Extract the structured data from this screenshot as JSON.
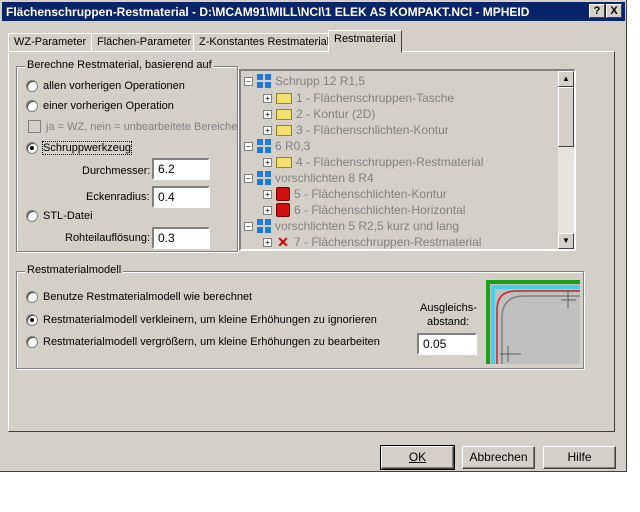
{
  "window": {
    "title": "Flächenschruppen-Restmaterial - D:\\MCAM91\\MILL\\NCI\\1 ELEK AS KOMPAKT.NCI - MPHEID",
    "help_button": "?",
    "close_button": "X"
  },
  "tabs": [
    {
      "label": "WZ-Parameter"
    },
    {
      "label": "Flächen-Parameter"
    },
    {
      "label": "Z-Konstantes Restmaterial"
    },
    {
      "label": "Restmaterial"
    }
  ],
  "calc_group": {
    "title": "Berechne Restmaterial, basierend auf",
    "options": [
      {
        "label": "allen vorherigen Operationen",
        "selected": false
      },
      {
        "label": "einer vorherigen Operation",
        "selected": false
      },
      {
        "label": "Schruppwerkzeug",
        "selected": true
      },
      {
        "label": "STL-Datei",
        "selected": false
      }
    ],
    "checkbox_label": "ja = WZ, nein = unbearbeitete Bereiche",
    "durchmesser_label": "Durchmesser:",
    "durchmesser_value": "6.2",
    "eckenradius_label": "Eckenradius:",
    "eckenradius_value": "0.4",
    "rohteil_label": "Rohteilauflösung:",
    "rohteil_value": "0.3"
  },
  "tree": {
    "items": [
      {
        "text": "Schrupp 12 R1,5",
        "kind": "group"
      },
      {
        "text": "1 - Flächenschruppen-Tasche",
        "kind": "folder"
      },
      {
        "text": "2 - Kontur (2D)",
        "kind": "folder"
      },
      {
        "text": "3 - Flächenschlichten-Kontur",
        "kind": "folder"
      },
      {
        "text": "6 R0,3",
        "kind": "group"
      },
      {
        "text": "4 - Flächenschruppen-Restmaterial",
        "kind": "folder"
      },
      {
        "text": "vorschlichten 8 R4",
        "kind": "group"
      },
      {
        "text": "5 - Flächenschlichten-Kontur",
        "kind": "red"
      },
      {
        "text": "6 - Flächenschlichten-Horizontal",
        "kind": "red"
      },
      {
        "text": "vorschlichten 5 R2,5 kurz und lang",
        "kind": "group"
      },
      {
        "text": "7 - Flächenschruppen-Restmaterial",
        "kind": "x"
      }
    ]
  },
  "model_group": {
    "title": "Restmaterialmodell",
    "options": [
      {
        "label": "Benutze Restmaterialmodell wie berechnet",
        "selected": false
      },
      {
        "label": "Restmaterialmodell verkleinern, um kleine Erhöhungen zu ignorieren",
        "selected": true
      },
      {
        "label": "Restmaterialmodell vergrößern, um kleine Erhöhungen zu bearbeiten",
        "selected": false
      }
    ],
    "ausgleich_label_1": "Ausgleichs-",
    "ausgleich_label_2": "abstand:",
    "ausgleich_value": "0.05"
  },
  "buttons": {
    "ok": "OK",
    "cancel": "Abbrechen",
    "help": "Hilfe"
  }
}
